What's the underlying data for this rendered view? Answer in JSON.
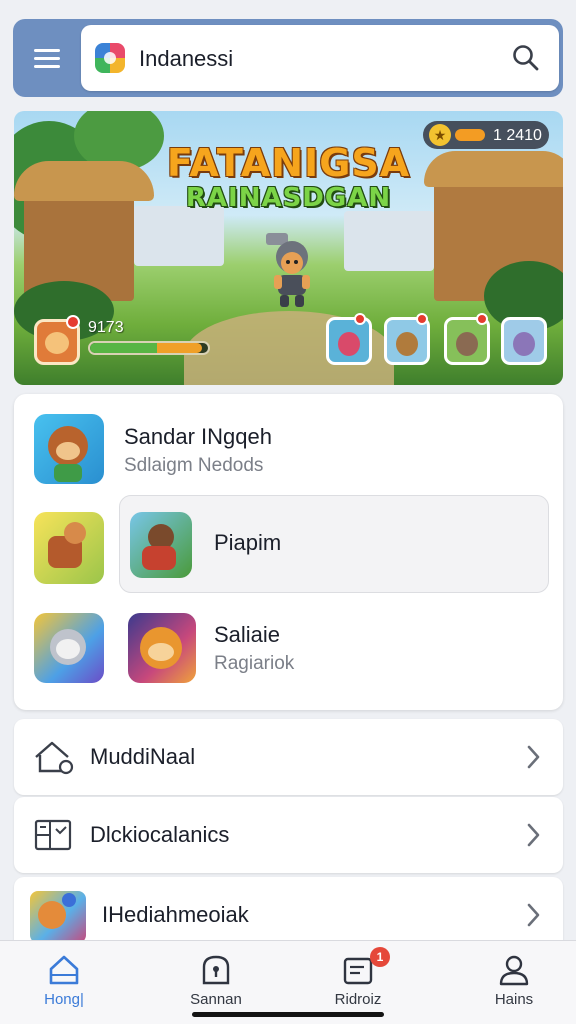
{
  "header": {
    "menu_icon": "hamburger-menu-icon",
    "app_logo_icon": "colorful-app-logo",
    "search_text": "Indanessi",
    "search_icon": "magnifier-icon"
  },
  "banner": {
    "title_line1": "FATANIGSA",
    "title_line2": "RAINASDGAN",
    "stat_value": "1 2410",
    "player_score": "9173",
    "progress_fraction": 0.95,
    "accent_colors": {
      "green": "#58b544",
      "orange": "#f0a028"
    }
  },
  "games": [
    {
      "title": "Sandar INgqeh",
      "subtitle": "Sdlaigm Nedods"
    },
    {
      "title": "Piapim",
      "subtitle": ""
    },
    {
      "title": "Saliaie",
      "subtitle": "Ragiariok"
    }
  ],
  "menu": [
    {
      "label": "MuddiNaal",
      "icon": "house-icon"
    },
    {
      "label": "Dlckiocalanics",
      "icon": "board-icon"
    },
    {
      "label": "IHediahmeoiak",
      "icon": "game-art-icon"
    }
  ],
  "nav": [
    {
      "label": "Hong|",
      "icon": "home-icon",
      "active": true
    },
    {
      "label": "Sannan",
      "icon": "lock-icon",
      "active": false
    },
    {
      "label": "Ridroiz",
      "icon": "inbox-icon",
      "active": false,
      "badge": "1"
    },
    {
      "label": "Hains",
      "icon": "profile-icon",
      "active": false
    }
  ],
  "colors": {
    "header": "#6e8fc0",
    "accent": "#3b7bd8",
    "badge": "#e5483a"
  }
}
